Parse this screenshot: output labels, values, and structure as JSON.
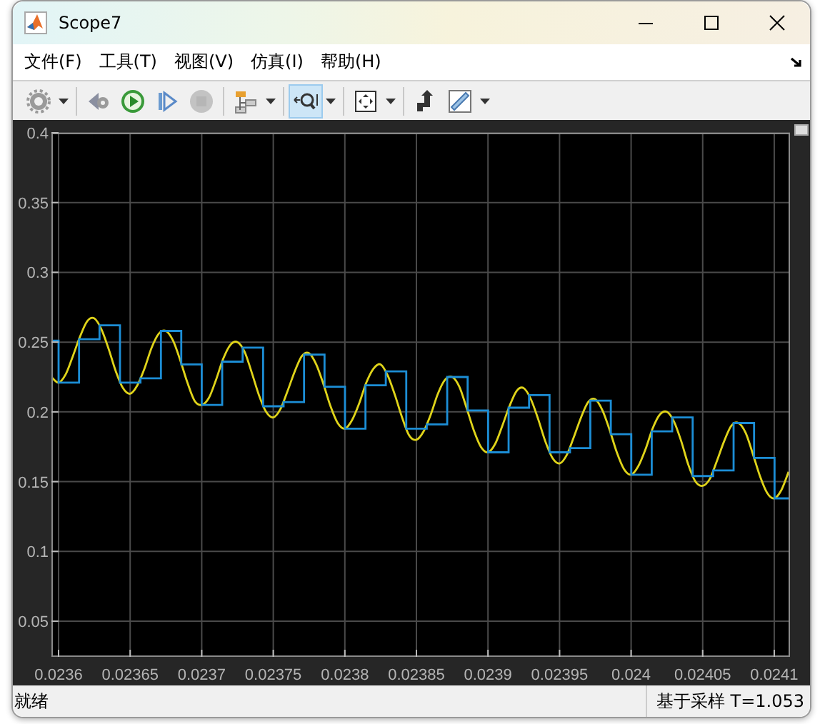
{
  "window": {
    "title": "Scope7"
  },
  "menu": [
    {
      "label": "文件(F)"
    },
    {
      "label": "工具(T)"
    },
    {
      "label": "视图(V)"
    },
    {
      "label": "仿真(I)"
    },
    {
      "label": "帮助(H)"
    }
  ],
  "toolbar": [
    [
      {
        "kind": "settings",
        "selected": false,
        "disabled": false,
        "dropdown": true
      }
    ],
    [
      {
        "kind": "step-back",
        "selected": false,
        "disabled": false,
        "dropdown": false
      },
      {
        "kind": "run",
        "selected": false,
        "disabled": false,
        "dropdown": false
      },
      {
        "kind": "step-forward",
        "selected": false,
        "disabled": false,
        "dropdown": false
      },
      {
        "kind": "stop",
        "selected": false,
        "disabled": true,
        "dropdown": false
      }
    ],
    [
      {
        "kind": "signals",
        "selected": false,
        "disabled": false,
        "dropdown": true
      }
    ],
    [
      {
        "kind": "zoom",
        "selected": true,
        "disabled": false,
        "dropdown": true
      }
    ],
    [
      {
        "kind": "fit",
        "selected": false,
        "disabled": false,
        "dropdown": true
      }
    ],
    [
      {
        "kind": "triggers",
        "selected": false,
        "disabled": false,
        "dropdown": false
      },
      {
        "kind": "measure",
        "selected": false,
        "disabled": false,
        "dropdown": true
      }
    ]
  ],
  "plot": {
    "chart_data": {
      "type": "line",
      "grid": true,
      "xlim": [
        0.023595,
        0.024111
      ],
      "ylim": [
        0.0244,
        0.4
      ],
      "xticks": [
        0.0236,
        0.02365,
        0.0237,
        0.02375,
        0.0238,
        0.02385,
        0.0239,
        0.02395,
        0.024,
        0.02405,
        0.0241
      ],
      "yticks": [
        0.05,
        0.1,
        0.15,
        0.2,
        0.25,
        0.3,
        0.35,
        0.4
      ],
      "series": [
        {
          "color": "#e0d41a",
          "x": [
            0.023595,
            0.0236,
            0.023605,
            0.02361,
            0.023615,
            0.02362,
            0.023625,
            0.02363,
            0.023635,
            0.02364,
            0.023645,
            0.02365,
            0.023655,
            0.02366,
            0.023665,
            0.02367,
            0.023675,
            0.02368,
            0.023685,
            0.02369,
            0.023695,
            0.0237,
            0.023705,
            0.02371,
            0.023715,
            0.02372,
            0.023725,
            0.02373,
            0.023735,
            0.02374,
            0.023745,
            0.02375,
            0.023755,
            0.02376,
            0.023765,
            0.02377,
            0.023775,
            0.02378,
            0.023785,
            0.02379,
            0.023795,
            0.0238,
            0.023805,
            0.02381,
            0.023815,
            0.02382,
            0.023825,
            0.02383,
            0.023835,
            0.02384,
            0.023845,
            0.02385,
            0.023855,
            0.02386,
            0.023865,
            0.02387,
            0.023875,
            0.02388,
            0.023885,
            0.02389,
            0.023895,
            0.0239,
            0.023905,
            0.02391,
            0.023915,
            0.02392,
            0.023925,
            0.02393,
            0.023935,
            0.02394,
            0.023945,
            0.02395,
            0.023955,
            0.02396,
            0.023965,
            0.02397,
            0.023975,
            0.02398,
            0.023985,
            0.02399,
            0.023995,
            0.024,
            0.024005,
            0.02401,
            0.024015,
            0.02402,
            0.024025,
            0.02403,
            0.024035,
            0.02404,
            0.024045,
            0.02405,
            0.024055,
            0.02406,
            0.024065,
            0.02407,
            0.024075,
            0.02408,
            0.024085,
            0.02409,
            0.024095,
            0.0241,
            0.024105,
            0.02411
          ],
          "values": [
            0.225,
            0.221,
            0.227,
            0.24,
            0.254,
            0.265,
            0.267,
            0.259,
            0.245,
            0.229,
            0.217,
            0.213,
            0.219,
            0.231,
            0.246,
            0.256,
            0.258,
            0.251,
            0.237,
            0.221,
            0.208,
            0.205,
            0.21,
            0.223,
            0.238,
            0.248,
            0.25,
            0.243,
            0.228,
            0.212,
            0.2,
            0.196,
            0.202,
            0.215,
            0.229,
            0.24,
            0.242,
            0.234,
            0.22,
            0.204,
            0.192,
            0.188,
            0.194,
            0.206,
            0.221,
            0.231,
            0.234,
            0.226,
            0.212,
            0.196,
            0.183,
            0.18,
            0.186,
            0.198,
            0.213,
            0.223,
            0.225,
            0.218,
            0.203,
            0.187,
            0.175,
            0.171,
            0.177,
            0.19,
            0.204,
            0.215,
            0.217,
            0.209,
            0.195,
            0.179,
            0.167,
            0.163,
            0.169,
            0.182,
            0.196,
            0.207,
            0.209,
            0.201,
            0.187,
            0.171,
            0.159,
            0.155,
            0.161,
            0.173,
            0.188,
            0.198,
            0.2,
            0.193,
            0.179,
            0.162,
            0.15,
            0.147,
            0.152,
            0.165,
            0.179,
            0.19,
            0.192,
            0.185,
            0.17,
            0.154,
            0.142,
            0.138,
            0.144,
            0.157
          ]
        },
        {
          "color": "#1c8ed6",
          "x": [
            0.023595,
            0.0236,
            0.0236,
            0.0236143,
            0.0236143,
            0.0236286,
            0.0236286,
            0.0236429,
            0.0236429,
            0.0236572,
            0.0236572,
            0.0236715,
            0.0236715,
            0.0236857,
            0.0236857,
            0.0237,
            0.0237,
            0.0237143,
            0.0237143,
            0.0237286,
            0.0237286,
            0.0237429,
            0.0237429,
            0.0237572,
            0.0237572,
            0.0237715,
            0.0237715,
            0.0237858,
            0.0237858,
            0.0238001,
            0.0238001,
            0.0238144,
            0.0238144,
            0.0238286,
            0.0238286,
            0.0238429,
            0.0238429,
            0.0238572,
            0.0238572,
            0.0238715,
            0.0238715,
            0.0238858,
            0.0238858,
            0.0239001,
            0.0239001,
            0.0239144,
            0.0239144,
            0.0239287,
            0.0239287,
            0.023943,
            0.023943,
            0.0239573,
            0.0239573,
            0.0239715,
            0.0239715,
            0.0239858,
            0.0239858,
            0.0240001,
            0.0240001,
            0.0240144,
            0.0240144,
            0.0240287,
            0.0240287,
            0.024043,
            0.024043,
            0.0240573,
            0.0240573,
            0.0240716,
            0.0240716,
            0.0240859,
            0.0240859,
            0.0241002,
            0.0241002,
            0.024111
          ],
          "values": [
            0.251,
            0.251,
            0.221,
            0.221,
            0.252,
            0.252,
            0.262,
            0.262,
            0.221,
            0.221,
            0.224,
            0.224,
            0.258,
            0.258,
            0.234,
            0.234,
            0.205,
            0.205,
            0.236,
            0.236,
            0.246,
            0.246,
            0.204,
            0.204,
            0.207,
            0.207,
            0.241,
            0.241,
            0.218,
            0.218,
            0.188,
            0.188,
            0.219,
            0.219,
            0.229,
            0.229,
            0.188,
            0.188,
            0.191,
            0.191,
            0.225,
            0.225,
            0.201,
            0.201,
            0.171,
            0.171,
            0.203,
            0.203,
            0.212,
            0.212,
            0.171,
            0.171,
            0.174,
            0.174,
            0.208,
            0.208,
            0.184,
            0.184,
            0.155,
            0.155,
            0.186,
            0.186,
            0.196,
            0.196,
            0.154,
            0.154,
            0.158,
            0.158,
            0.192,
            0.192,
            0.167,
            0.167,
            0.138,
            0.138
          ]
        }
      ]
    }
  },
  "status_bar": {
    "left": "就绪",
    "right": "基于采样 T=1.053"
  }
}
